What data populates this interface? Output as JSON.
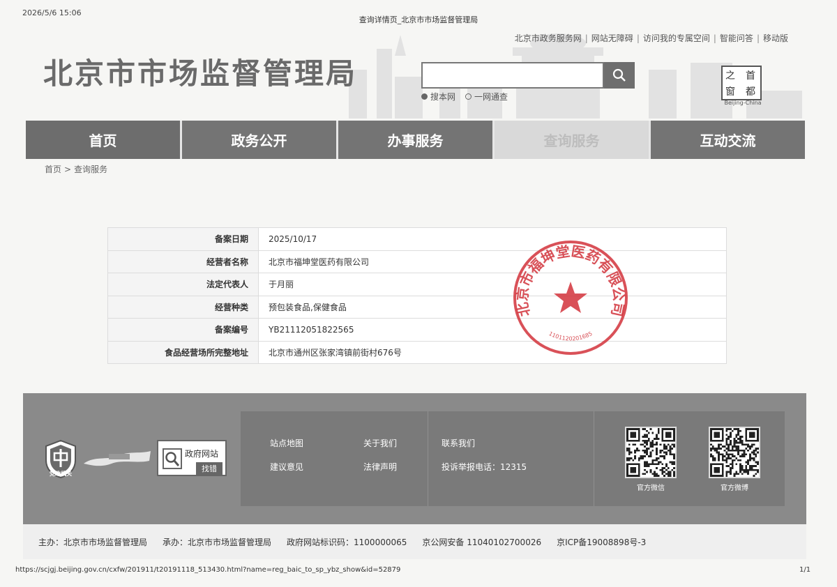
{
  "print": {
    "datetime": "2026/5/6 15:06",
    "page_title": "查询详情页_北京市市场监督管理局",
    "url": "https://scjgj.beijing.gov.cn/cxfw/201911/t20191118_513430.html?name=reg_baic_to_sp_ybz_show&id=52879",
    "page_number": "1/1"
  },
  "header": {
    "top_links": [
      "北京市政务服务网",
      "网站无障碍",
      "访问我的专属空间",
      "智能问答",
      "移动版"
    ],
    "link_separator": "|",
    "site_title": "北京市市场监督管理局",
    "search": {
      "value": "",
      "options": [
        {
          "label": "搜本网",
          "selected": true
        },
        {
          "label": "一网通查",
          "selected": false
        }
      ]
    },
    "capital_logo": {
      "cells": [
        "之",
        "首",
        "窗",
        "都"
      ],
      "caption": "Beijing-China"
    }
  },
  "nav": {
    "items": [
      {
        "label": "首页",
        "active": false
      },
      {
        "label": "政务公开",
        "active": false
      },
      {
        "label": "办事服务",
        "active": false
      },
      {
        "label": "查询服务",
        "active": true
      },
      {
        "label": "互动交流",
        "active": false
      }
    ]
  },
  "breadcrumb": {
    "home": "首页",
    "separator": ">",
    "current": "查询服务"
  },
  "record": {
    "rows": [
      {
        "key": "备案日期",
        "value": "2025/10/17"
      },
      {
        "key": "经营者名称",
        "value": "北京市福坤堂医药有限公司"
      },
      {
        "key": "法定代表人",
        "value": "于月丽"
      },
      {
        "key": "经营种类",
        "value": "预包装食品,保健食品"
      },
      {
        "key": "备案编号",
        "value": "YB21112051822565"
      },
      {
        "key": "食品经营场所完整地址",
        "value": "北京市通州区张家湾镇前街村676号"
      }
    ]
  },
  "seal": {
    "text": "北京市福坤堂医药有限公司",
    "number": "1101120201685",
    "color": "#d2333b"
  },
  "footer": {
    "emblem_caption": "党政机关",
    "findbug": {
      "line1": "政府网站",
      "line2": "找错"
    },
    "links": {
      "col1": [
        "站点地图",
        "建议意见"
      ],
      "col2": [
        "关于我们",
        "法律声明"
      ],
      "col3_title": "联系我们",
      "complaint": "投诉举报电话：12315"
    },
    "qr": [
      {
        "caption": "官方微信"
      },
      {
        "caption": "官方微博"
      }
    ],
    "bottom": {
      "sponsor": "主办：北京市市场监督管理局",
      "organizer": "承办：北京市市场监督管理局",
      "site_id": "政府网站标识码：1100000065",
      "police": "京公网安备 11040102700026",
      "icp": "京ICP备19008898号-3"
    }
  },
  "colors": {
    "nav": "#747474",
    "nav_active": "#d9d9d9",
    "footer": "#8a8a8a",
    "seal": "#d2333b"
  }
}
